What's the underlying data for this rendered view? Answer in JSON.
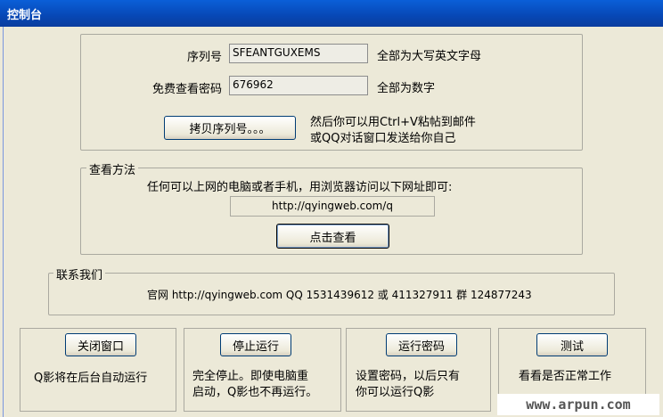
{
  "window": {
    "title": "控制台"
  },
  "serial": {
    "label": "序列号",
    "value": "SFEANTGUXEMS",
    "hint": "全部为大写英文字母"
  },
  "password": {
    "label": "免费查看密码",
    "value": "676962",
    "hint": "全部为数字"
  },
  "copy": {
    "button_label": "拷贝序列号。。。",
    "hint_line1": "然后你可以用Ctrl+V粘帖到邮件",
    "hint_line2": "或QQ对话窗口发送给你自己"
  },
  "view_method": {
    "legend": "查看方法",
    "description": "任何可以上网的电脑或者手机，用浏览器访问以下网址即可:",
    "url": "http://qyingweb.com/q",
    "button_label": "点击查看"
  },
  "contact": {
    "legend": "联系我们",
    "text": "官网 http://qyingweb.com QQ 1531439612 或 411327911 群 124877243"
  },
  "actions": [
    {
      "button_label": "关闭窗口",
      "desc_line1": "Q影将在后台自动运行",
      "desc_line2": ""
    },
    {
      "button_label": "停止运行",
      "desc_line1": "完全停止。即使电脑重",
      "desc_line2": "启动，Q影也不再运行。"
    },
    {
      "button_label": "运行密码",
      "desc_line1": "设置密码，以后只有",
      "desc_line2": "你可以运行Q影"
    },
    {
      "button_label": "测试",
      "desc_line1": "看看是否正常工作",
      "desc_line2": ""
    }
  ],
  "watermark": "www.arpun.com"
}
